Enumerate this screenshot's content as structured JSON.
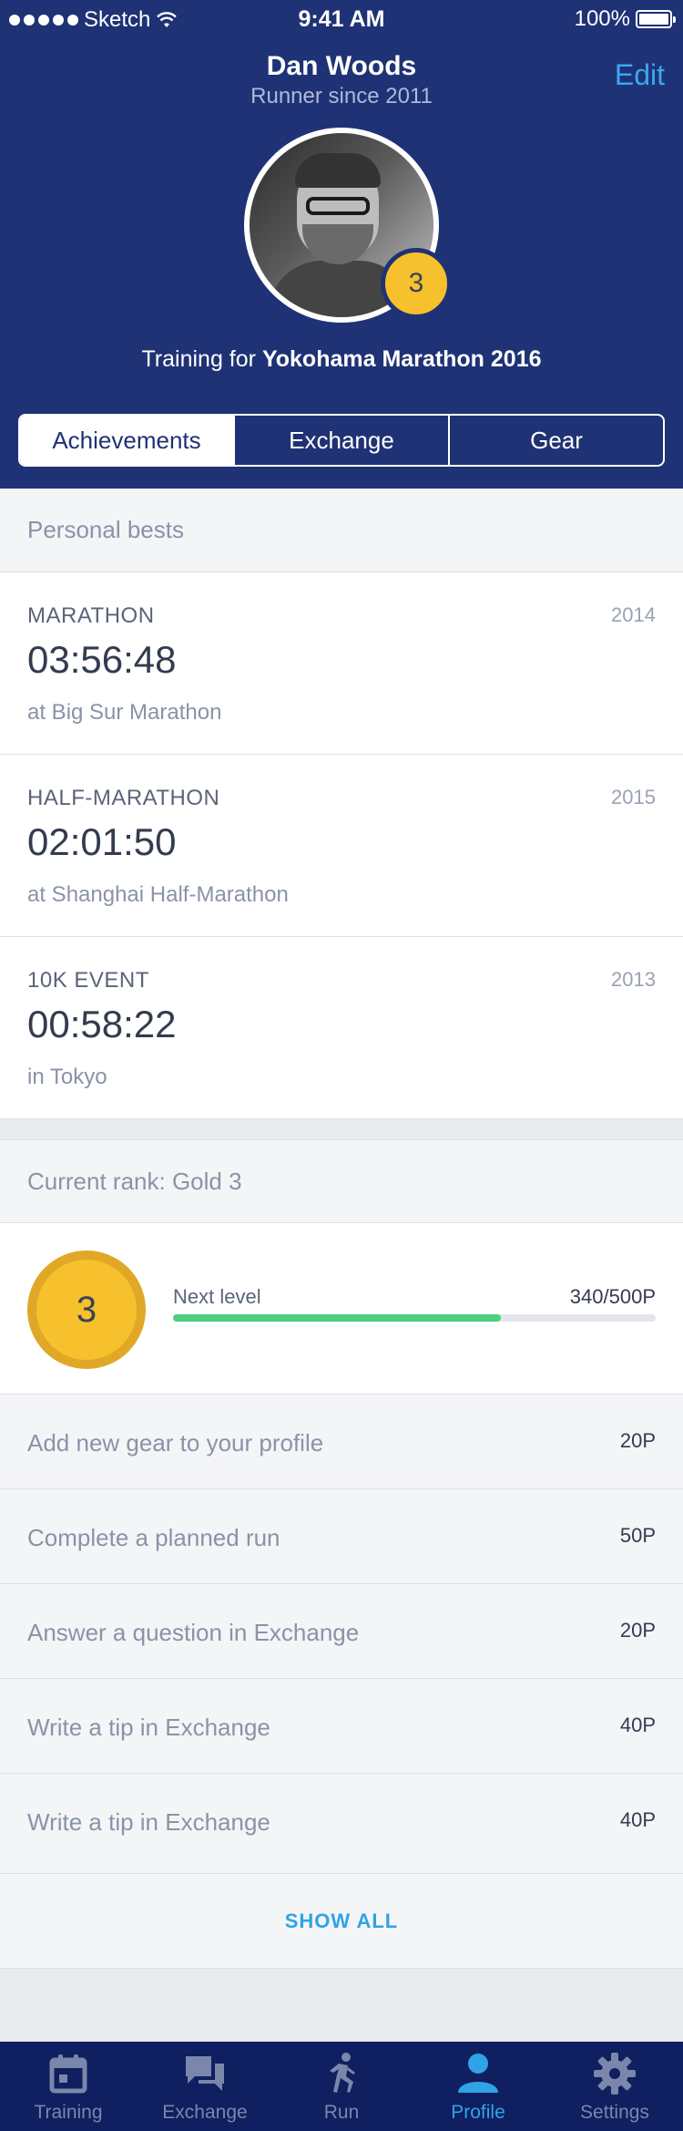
{
  "status_bar": {
    "carrier": "Sketch",
    "time": "9:41 AM",
    "battery": "100%"
  },
  "header": {
    "name": "Dan Woods",
    "subtitle": "Runner since 2011",
    "edit_label": "Edit",
    "avatar_level": "3",
    "training_prefix": "Training for ",
    "training_event": "Yokohama Marathon 2016"
  },
  "tabs": [
    {
      "label": "Achievements",
      "active": true
    },
    {
      "label": "Exchange",
      "active": false
    },
    {
      "label": "Gear",
      "active": false
    }
  ],
  "personal_bests": {
    "title": "Personal bests",
    "items": [
      {
        "label": "MARATHON",
        "year": "2014",
        "time": "03:56:48",
        "place": "at Big Sur Marathon"
      },
      {
        "label": "HALF-MARATHON",
        "year": "2015",
        "time": "02:01:50",
        "place": "at Shanghai Half-Marathon"
      },
      {
        "label": "10K EVENT",
        "year": "2013",
        "time": "00:58:22",
        "place": "in Tokyo"
      }
    ]
  },
  "rank": {
    "title": "Current rank: Gold 3",
    "level": "3",
    "next_level_label": "Next level",
    "points_text": "340/500P",
    "progress_fraction": 0.68
  },
  "tasks": [
    {
      "label": "Add new gear to your profile",
      "points": "20P"
    },
    {
      "label": "Complete a planned run",
      "points": "50P"
    },
    {
      "label": "Answer a question in Exchange",
      "points": "20P"
    },
    {
      "label": "Write a tip in Exchange",
      "points": "40P"
    },
    {
      "label": "Write a tip in Exchange",
      "points": "40P"
    }
  ],
  "show_all_label": "SHOW ALL",
  "tabbar": [
    {
      "label": "Training",
      "icon": "calendar-icon",
      "active": false
    },
    {
      "label": "Exchange",
      "icon": "chat-icon",
      "active": false
    },
    {
      "label": "Run",
      "icon": "runner-icon",
      "active": false
    },
    {
      "label": "Profile",
      "icon": "person-icon",
      "active": true
    },
    {
      "label": "Settings",
      "icon": "gear-icon",
      "active": false
    }
  ],
  "colors": {
    "header_bg": "#1f3275",
    "accent": "#2fa3e6",
    "badge_gold": "#f6c12c",
    "progress_green": "#4cd07d",
    "tabbar_bg": "#0f1f5f"
  }
}
